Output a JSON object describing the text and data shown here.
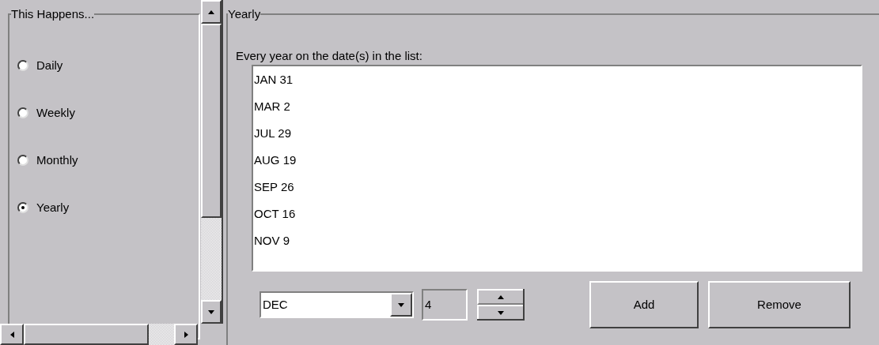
{
  "recurrence": {
    "title": "This Happens...",
    "options": [
      {
        "label": "Daily",
        "selected": false
      },
      {
        "label": "Weekly",
        "selected": false
      },
      {
        "label": "Monthly",
        "selected": false
      },
      {
        "label": "Yearly",
        "selected": true
      }
    ]
  },
  "yearly": {
    "title": "Yearly",
    "instruction": "Every year on the date(s) in the list:",
    "dates": [
      "JAN 31",
      "MAR 2",
      "JUL 29",
      "AUG 19",
      "SEP 26",
      "OCT 16",
      "NOV 9"
    ],
    "month": {
      "value": "DEC"
    },
    "day": {
      "value": "4",
      "disabled": true
    },
    "buttons": [
      "Add",
      "Remove"
    ]
  }
}
